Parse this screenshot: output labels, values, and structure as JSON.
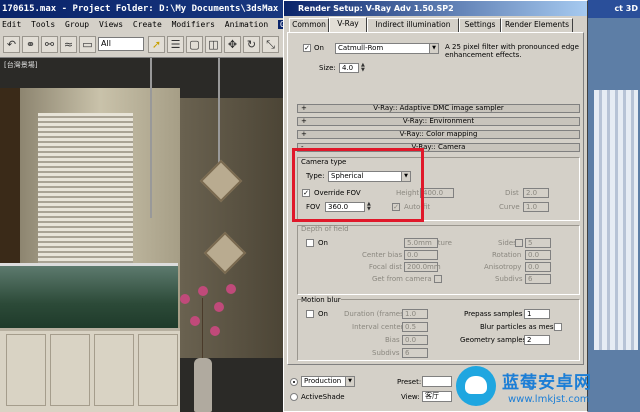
{
  "app": {
    "title": "170615.max  -  Project Folder: D:\\My Documents\\3dsMax",
    "right_title": "ct 3D"
  },
  "menu": [
    "Edit",
    "Tools",
    "Group",
    "Views",
    "Create",
    "Modifiers",
    "Animation",
    "Graph Edito"
  ],
  "toolbar": {
    "selection_filter": "All"
  },
  "viewport": {
    "label": "[台灣景場]"
  },
  "dialog": {
    "title": "Render Setup: V-Ray Adv 1.50.SP2",
    "tabs": [
      "Common",
      "V-Ray",
      "Indirect illumination",
      "Settings",
      "Render Elements"
    ],
    "active_tab": "V-Ray",
    "filter": {
      "on_label": "On",
      "filter_value": "Catmull-Rom",
      "description": "A 25 pixel filter with pronounced edge enhancement effects.",
      "size_label": "Size:",
      "size_value": "4.0"
    },
    "rollouts": {
      "dmc": "V-Ray:: Adaptive DMC image sampler",
      "environment": "V-Ray:: Environment",
      "color_mapping": "V-Ray:: Color mapping",
      "camera": "V-Ray:: Camera"
    },
    "camera_type": {
      "group_label": "Camera type",
      "type_label": "Type:",
      "type_value": "Spherical",
      "override_fov_label": "Override FOV",
      "fov_label": "FOV",
      "fov_value": "360.0",
      "height_label": "Height",
      "height_value": "400.0",
      "auto_fit_label": "Auto-fit",
      "dist_label": "Dist",
      "dist_value": "2.0",
      "curve_label": "Curve",
      "curve_value": "1.0"
    },
    "dof": {
      "group_label": "Depth of field",
      "on_label": "On",
      "aperture_label": "Aperture",
      "aperture_value": "5.0mm",
      "center_bias_label": "Center bias",
      "center_bias_value": "0.0",
      "focal_dist_label": "Focal dist",
      "focal_dist_value": "200.0mm",
      "get_from_camera_label": "Get from camera",
      "sides_label": "Sides",
      "sides_value": "5",
      "rotation_label": "Rotation",
      "rotation_value": "0.0",
      "anisotropy_label": "Anisotropy",
      "anisotropy_value": "0.0",
      "subdivs_label": "Subdivs",
      "subdivs_value": "6"
    },
    "motion_blur": {
      "group_label": "Motion blur",
      "on_label": "On",
      "duration_label": "Duration (frames)",
      "duration_value": "1.0",
      "interval_label": "Interval center",
      "interval_value": "0.5",
      "bias_label": "Bias",
      "bias_value": "0.0",
      "subdivs_label": "Subdivs",
      "subdivs_value": "6",
      "prepass_label": "Prepass samples",
      "prepass_value": "1",
      "blur_particles_label": "Blur particles as mesh",
      "geometry_label": "Geometry samples",
      "geometry_value": "2"
    },
    "bottom": {
      "production_label": "Production",
      "activeshade_label": "ActiveShade",
      "preset_label": "Preset:",
      "view_label": "View:",
      "view_value": "客厅"
    }
  },
  "watermark": {
    "name": "蓝莓安卓网",
    "url": "www.lmkjst.com"
  },
  "colors": {
    "highlight": "#e0182a",
    "title_bar": "#0a246a",
    "panel": "#d4d0c8",
    "watermark": "#1c7ed6"
  }
}
